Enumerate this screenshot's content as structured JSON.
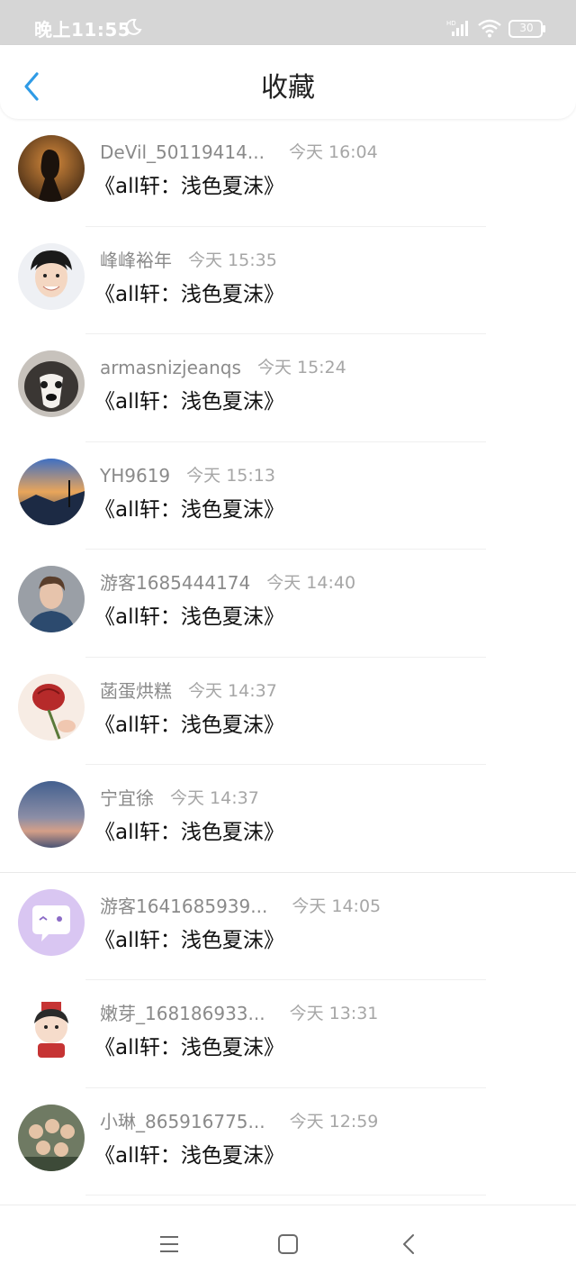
{
  "status_bar": {
    "time": "晚上11:55",
    "battery": "30",
    "network": "HD"
  },
  "header": {
    "title": "收藏",
    "back_icon": "chevron-left-icon"
  },
  "items": [
    {
      "username": "DeVil_50119414...",
      "time": "今天 16:04",
      "content": "《all轩：浅色夏沫》"
    },
    {
      "username": "峰峰裕年",
      "time": "今天 15:35",
      "content": "《all轩：浅色夏沫》"
    },
    {
      "username": "armasnizjeanqs",
      "time": "今天 15:24",
      "content": "《all轩：浅色夏沫》"
    },
    {
      "username": "YH9619",
      "time": "今天 15:13",
      "content": "《all轩：浅色夏沫》"
    },
    {
      "username": "游客1685444174",
      "time": "今天 14:40",
      "content": "《all轩：浅色夏沫》"
    },
    {
      "username": "菡蛋烘糕",
      "time": "今天 14:37",
      "content": "《all轩：浅色夏沫》"
    },
    {
      "username": "宁宜徐",
      "time": "今天 14:37",
      "content": "《all轩：浅色夏沫》"
    },
    {
      "username": "游客1641685939...",
      "time": "今天 14:05",
      "content": "《all轩：浅色夏沫》"
    },
    {
      "username": "嫩芽_168186933...",
      "time": "今天 13:31",
      "content": "《all轩：浅色夏沫》"
    },
    {
      "username": "小琳_865916775...",
      "time": "今天 12:59",
      "content": "《all轩：浅色夏沫》"
    }
  ],
  "nav_bar": {
    "menu_icon": "menu-icon",
    "home_icon": "home-square-icon",
    "back_icon": "back-triangle-icon"
  },
  "colors": {
    "accent": "#2f9be6",
    "status_bar_bg": "#d6d6d6",
    "username": "#8a8a8a",
    "time": "#a6a6a6",
    "content": "#111111"
  }
}
